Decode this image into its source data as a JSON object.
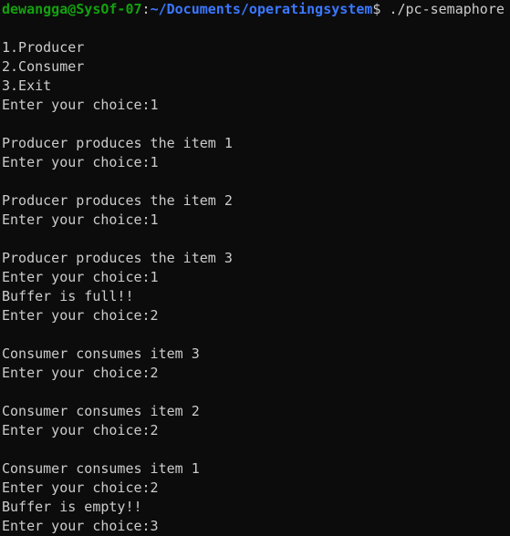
{
  "prompt": {
    "user_host": "dewangga@SysOf-07",
    "colon": ":",
    "path": "~/Documents/operatingsystem",
    "dollar": "$ ",
    "command": "./pc-semaphore"
  },
  "output_lines": [
    "",
    "1.Producer",
    "2.Consumer",
    "3.Exit",
    "Enter your choice:1",
    "",
    "Producer produces the item 1",
    "Enter your choice:1",
    "",
    "Producer produces the item 2",
    "Enter your choice:1",
    "",
    "Producer produces the item 3",
    "Enter your choice:1",
    "Buffer is full!!",
    "Enter your choice:2",
    "",
    "Consumer consumes item 3",
    "Enter your choice:2",
    "",
    "Consumer consumes item 2",
    "Enter your choice:2",
    "",
    "Consumer consumes item 1",
    "Enter your choice:2",
    "Buffer is empty!!",
    "Enter your choice:3"
  ],
  "colors": {
    "background": "#0c0c0c",
    "foreground": "#cccccc",
    "user_host": "#13a10e",
    "path": "#3b78ff"
  }
}
